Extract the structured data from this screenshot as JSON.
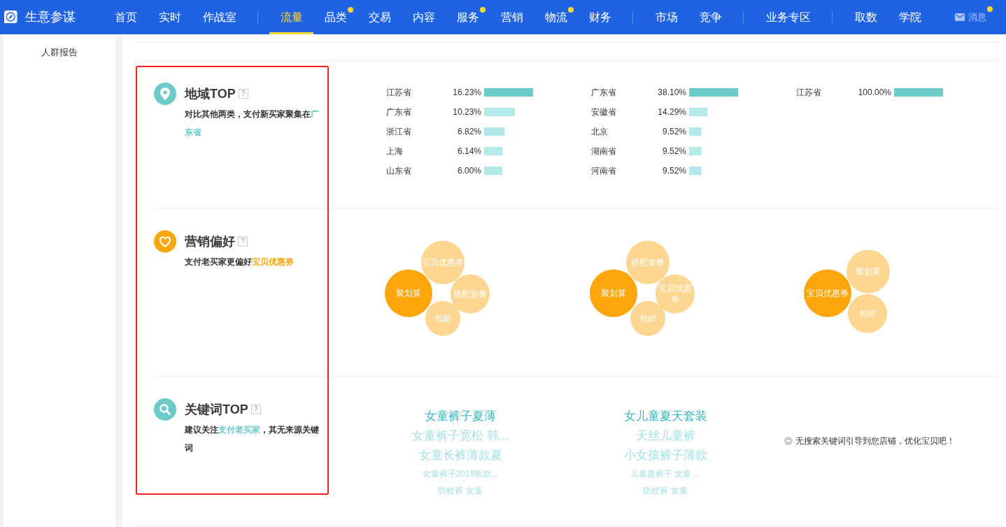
{
  "nav": {
    "logo_text": "生意参谋",
    "groups": [
      {
        "items": [
          {
            "label": "首页",
            "selected": false,
            "dot": false
          },
          {
            "label": "实时",
            "selected": false,
            "dot": false
          },
          {
            "label": "作战室",
            "selected": false,
            "dot": false
          }
        ]
      },
      {
        "items": [
          {
            "label": "流量",
            "selected": true,
            "dot": false
          },
          {
            "label": "品类",
            "selected": false,
            "dot": true
          },
          {
            "label": "交易",
            "selected": false,
            "dot": false
          },
          {
            "label": "内容",
            "selected": false,
            "dot": false
          },
          {
            "label": "服务",
            "selected": false,
            "dot": true
          },
          {
            "label": "营销",
            "selected": false,
            "dot": false
          },
          {
            "label": "物流",
            "selected": false,
            "dot": true
          },
          {
            "label": "财务",
            "selected": false,
            "dot": false
          }
        ]
      },
      {
        "items": [
          {
            "label": "市场",
            "selected": false,
            "dot": false
          },
          {
            "label": "竞争",
            "selected": false,
            "dot": false
          }
        ]
      },
      {
        "items": [
          {
            "label": "业务专区",
            "selected": false,
            "dot": false
          }
        ]
      },
      {
        "items": [
          {
            "label": "取数",
            "selected": false,
            "dot": false
          },
          {
            "label": "学院",
            "selected": false,
            "dot": false
          }
        ]
      }
    ],
    "messages": {
      "label": "消息",
      "dot": true
    }
  },
  "sidebar": {
    "items": [
      {
        "label": "人群报告"
      }
    ]
  },
  "annotation": {
    "highlight_frame": true
  },
  "sections": [
    {
      "kind": "region",
      "color": "#6ccac9",
      "title": "地域TOP",
      "help": "?",
      "description": [
        {
          "text": "对比其他两类，支付新买家聚集在",
          "highlighted": false
        },
        {
          "text": "广东省",
          "highlighted": true
        }
      ],
      "columns": [
        {
          "chart_data": {
            "type": "bar",
            "orientation": "horizontal",
            "categories": [
              "江苏省",
              "广东省",
              "浙江省",
              "上海",
              "山东省"
            ],
            "series": [
              {
                "color": "#6ccac9",
                "values": [
                  16.23,
                  null,
                  null,
                  null,
                  null
                ],
                "value_labels": [
                  "16.23%",
                  null,
                  null,
                  null,
                  null
                ]
              },
              {
                "color": "#b3e9e9",
                "values": [
                  null,
                  10.23,
                  6.82,
                  6.14,
                  6.0
                ],
                "value_labels": [
                  null,
                  "10.23%",
                  "6.82%",
                  "6.14%",
                  "6.00%"
                ]
              }
            ]
          }
        },
        {
          "chart_data": {
            "type": "bar",
            "orientation": "horizontal",
            "categories": [
              "广东省",
              "安徽省",
              "北京",
              "湖南省",
              "河南省"
            ],
            "series": [
              {
                "color": "#6ccac9",
                "values": [
                  38.1,
                  null,
                  null,
                  null,
                  null
                ],
                "value_labels": [
                  "38.10%",
                  null,
                  null,
                  null,
                  null
                ]
              },
              {
                "color": "#b3e9e9",
                "values": [
                  null,
                  14.29,
                  9.52,
                  9.52,
                  9.52
                ],
                "value_labels": [
                  null,
                  "14.29%",
                  "9.52%",
                  "9.52%",
                  "9.52%"
                ]
              }
            ]
          }
        },
        {
          "chart_data": {
            "type": "bar",
            "orientation": "horizontal",
            "categories": [
              "江苏省"
            ],
            "series": [
              {
                "color": "#6ccac9",
                "values": [
                  100
                ],
                "value_labels": [
                  "100.00%"
                ]
              }
            ]
          }
        }
      ]
    },
    {
      "kind": "marketing",
      "color": "#fca60b",
      "title": "营销偏好",
      "help": "?",
      "description": [
        {
          "text": "支付老买家更偏好",
          "highlighted": false
        },
        {
          "text": "宝贝优惠券",
          "highlighted": true
        }
      ],
      "columns": [
        {
          "bubbles": [
            {
              "label": "聚划算",
              "highlighted": true
            },
            {
              "label": "宝贝优惠券",
              "highlighted": false
            },
            {
              "label": "搭配套餐",
              "highlighted": false
            },
            {
              "label": "包邮",
              "highlighted": false
            }
          ]
        },
        {
          "bubbles": [
            {
              "label": "聚划算",
              "highlighted": true
            },
            {
              "label": "搭配套餐",
              "highlighted": false
            },
            {
              "label": "宝贝优惠券",
              "highlighted": false
            },
            {
              "label": "包邮",
              "highlighted": false
            }
          ]
        },
        {
          "bubbles": [
            {
              "label": "宝贝优惠券",
              "highlighted": true
            },
            {
              "label": "聚划算",
              "highlighted": false
            },
            {
              "label": "包邮",
              "highlighted": false
            }
          ]
        }
      ]
    },
    {
      "kind": "keywords",
      "color": "#6ccac9",
      "title": "关键词TOP",
      "help": "?",
      "description": [
        {
          "text": "建议关注",
          "highlighted": false
        },
        {
          "text": "支付老买家",
          "highlighted": true
        },
        {
          "text": "，其无来源关键词",
          "highlighted": false
        }
      ],
      "columns": [
        {
          "keywords": [
            {
              "text": "女童裤子夏薄",
              "kind": "top"
            },
            {
              "text": "女童裤子宽松 韩...",
              "kind": "large"
            },
            {
              "text": "女童长裤薄款夏",
              "kind": "large"
            },
            {
              "text": "女童裤子2019新款...",
              "kind": "small"
            },
            {
              "text": "防蚊裤 女童",
              "kind": "small"
            }
          ]
        },
        {
          "keywords": [
            {
              "text": "女儿童夏天套装",
              "kind": "top"
            },
            {
              "text": "天丝儿童裤",
              "kind": "large"
            },
            {
              "text": "小女孩裤子薄款",
              "kind": "large"
            },
            {
              "text": "儿童夏裤子 女童 ...",
              "kind": "small"
            },
            {
              "text": "防蚊裤 女童",
              "kind": "small"
            }
          ]
        },
        {
          "empty_message": "无搜索关键词引导到您店铺，优化宝贝吧！"
        }
      ]
    }
  ]
}
